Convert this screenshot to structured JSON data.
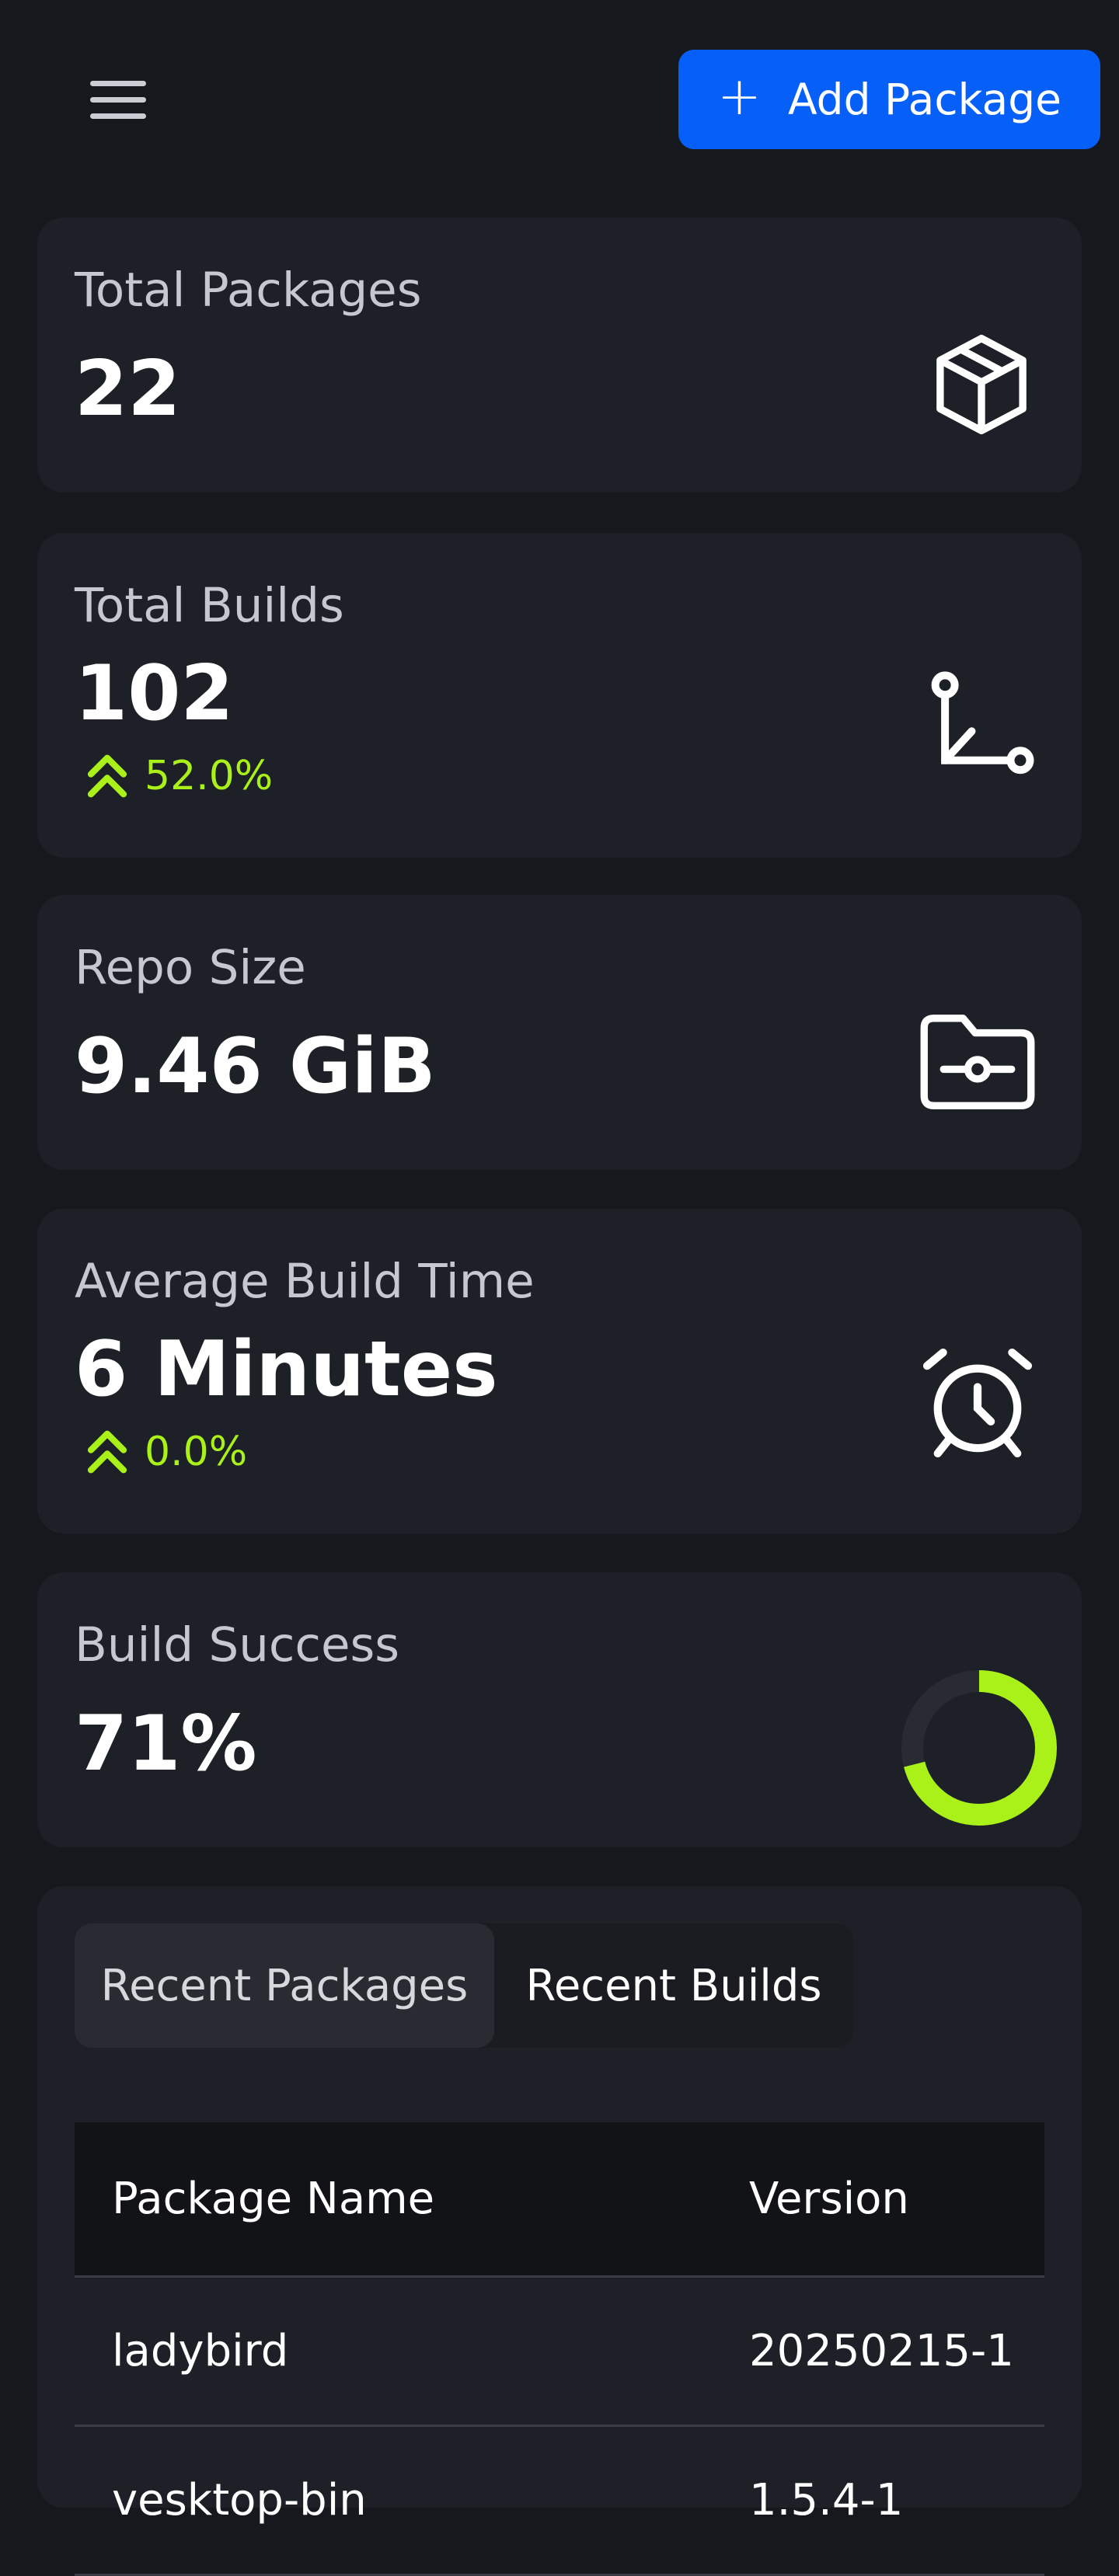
{
  "header": {
    "add_button_label": "Add Package"
  },
  "stats": {
    "total_packages": {
      "label": "Total Packages",
      "value": "22"
    },
    "total_builds": {
      "label": "Total Builds",
      "value": "102",
      "trend": "52.0%"
    },
    "repo_size": {
      "label": "Repo Size",
      "value": "9.46 GiB"
    },
    "avg_build_time": {
      "label": "Average Build Time",
      "value": "6 Minutes",
      "trend": "0.0%"
    },
    "build_success": {
      "label": "Build Success",
      "value": "71%",
      "percent": 71
    }
  },
  "tabs": {
    "recent_packages": "Recent Packages",
    "recent_builds": "Recent Builds"
  },
  "table": {
    "headers": [
      "Package Name",
      "Version"
    ],
    "rows": [
      [
        "ladybird",
        "20250215-1"
      ],
      [
        "vesktop-bin",
        "1.5.4-1"
      ]
    ]
  },
  "colors": {
    "accent": "#0660f8",
    "success": "#aaf11a",
    "card": "#1d2027",
    "background": "#16181d"
  }
}
